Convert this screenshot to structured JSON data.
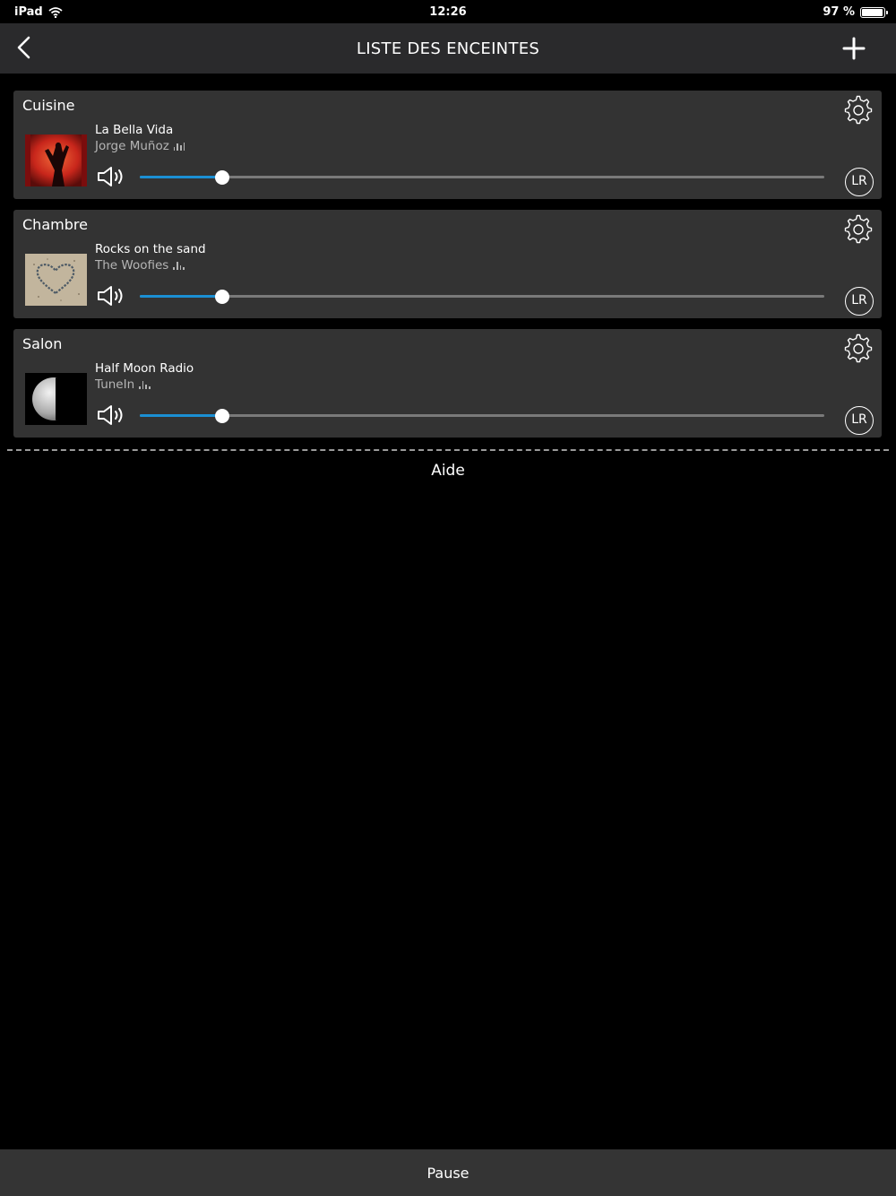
{
  "status_bar": {
    "device": "iPad",
    "time": "12:26",
    "battery": "97 %",
    "battery_level": 0.97
  },
  "nav": {
    "title": "LISTE DES ENCEINTES",
    "back_icon": "chevron-left-icon",
    "add_icon": "plus-icon"
  },
  "speakers": [
    {
      "room": "Cuisine",
      "track": "La Bella Vida",
      "artist": "Jorge Muñoz",
      "volume_fraction": 0.12,
      "channel": "LR"
    },
    {
      "room": "Chambre",
      "track": "Rocks on the sand",
      "artist": "The Woofies",
      "volume_fraction": 0.12,
      "channel": "LR"
    },
    {
      "room": "Salon",
      "track": "Half Moon Radio",
      "artist": "TuneIn",
      "volume_fraction": 0.12,
      "channel": "LR"
    }
  ],
  "help": {
    "label": "Aide"
  },
  "bottom": {
    "pause_label": "Pause"
  },
  "colors": {
    "accent": "#1b8fd3",
    "card": "#333333",
    "nav": "#2a2a2c"
  }
}
